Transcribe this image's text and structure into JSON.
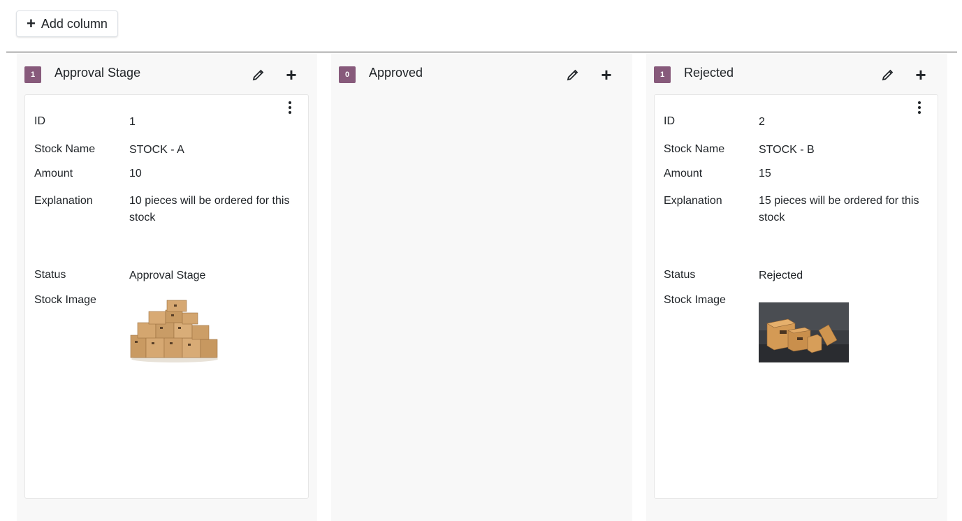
{
  "toolbar": {
    "add_column_label": "Add column",
    "add_icon": "plus-icon"
  },
  "labels": {
    "id": "ID",
    "stock_name": "Stock Name",
    "amount": "Amount",
    "explanation": "Explanation",
    "status": "Status",
    "stock_image": "Stock Image"
  },
  "columns": [
    {
      "title": "Approval Stage",
      "count": "1",
      "card": {
        "id": "1",
        "stock_name": "STOCK - A",
        "amount": "10",
        "explanation": "10 pieces will be ordered for this stock",
        "status": "Approval Stage",
        "image": "cardboard-box-pile-image"
      }
    },
    {
      "title": "Approved",
      "count": "0"
    },
    {
      "title": "Rejected",
      "count": "1",
      "card": {
        "id": "2",
        "stock_name": "STOCK - B",
        "amount": "15",
        "explanation": "15 pieces will be ordered for this stock",
        "status": "Rejected",
        "image": "cardboard-boxes-dark-background-image"
      }
    }
  ],
  "colors": {
    "badge": "#875a7b",
    "column_bg": "#f8f8f8",
    "card_bg": "#ffffff",
    "text": "#212529"
  }
}
